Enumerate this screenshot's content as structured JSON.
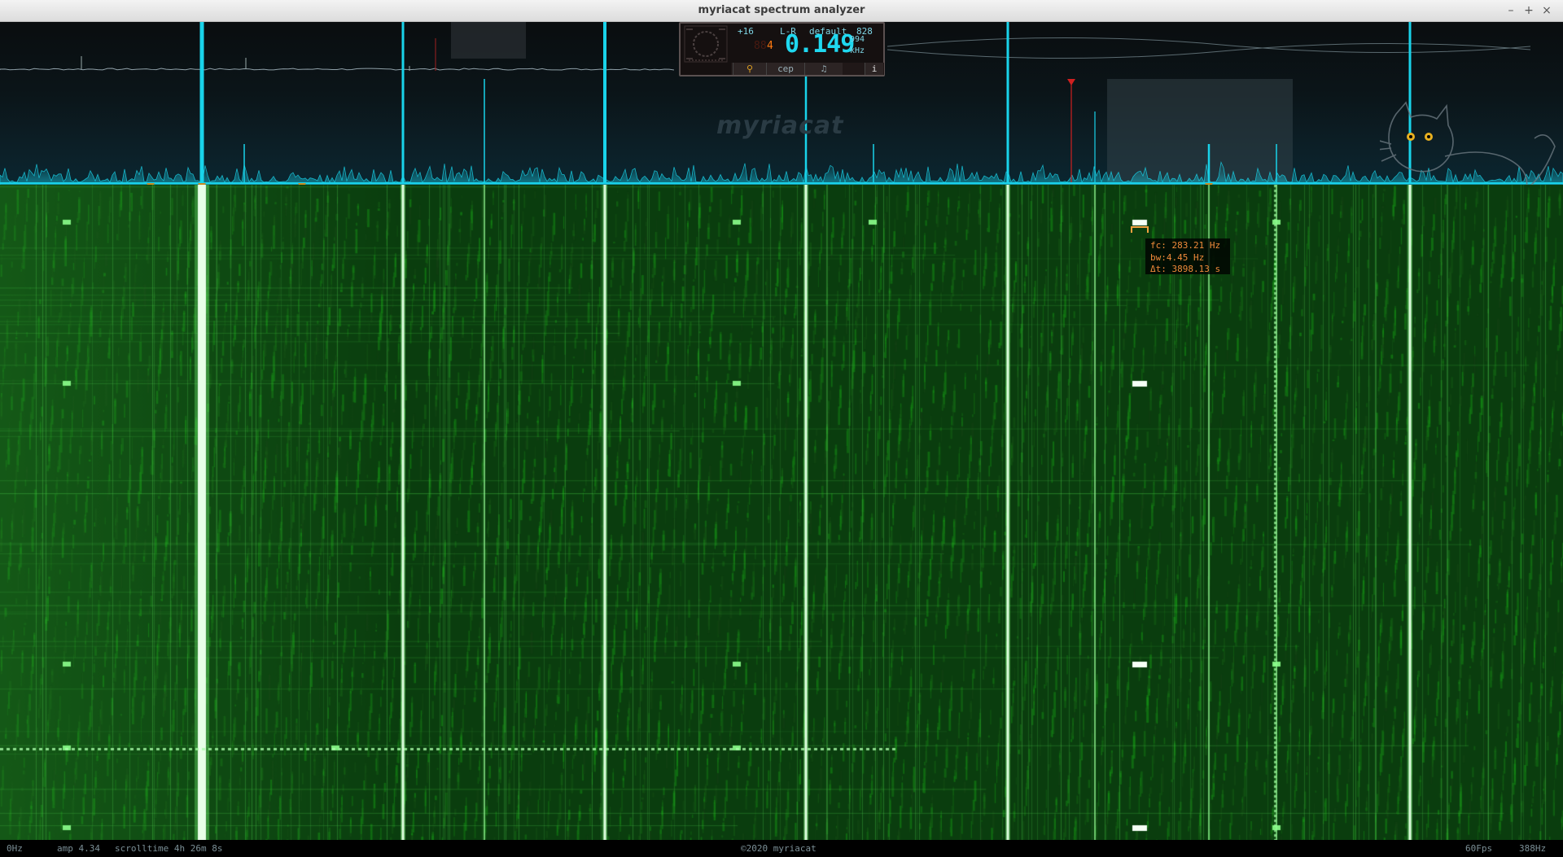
{
  "window": {
    "title": "myriacat spectrum analyzer",
    "controls": [
      "–",
      "+",
      "×"
    ]
  },
  "meter": {
    "level": "+16",
    "channel": "L-R",
    "preset": "default",
    "bins": "828",
    "counter": "4",
    "frequency": "0.149",
    "frequency_sub": "994",
    "unit": "kHz",
    "buttons": [
      "cep",
      "♫",
      "i"
    ]
  },
  "watermark": "myriacat",
  "tooltip": {
    "fc": "fc: 283.21 Hz",
    "bw": "bw:4.45 Hz",
    "dt": "Δt: 3898.13 s"
  },
  "status": {
    "left_freq": "0Hz",
    "amp": "amp 4.34",
    "scrolltime": "scrolltime 4h 26m 8s",
    "copyright": "©2020 myriacat",
    "fps": "60Fps",
    "right_freq": "388Hz"
  },
  "colors": {
    "spectrum_peak": "#19d3ea",
    "waterfall_base": "#0b4a12",
    "waterfall_bright": "#7dff7a",
    "tooltip_text": "#f08a3a"
  }
}
